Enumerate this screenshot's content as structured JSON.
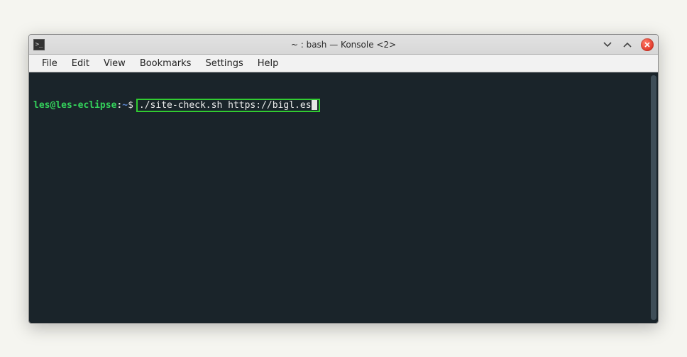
{
  "window": {
    "title": "~ : bash — Konsole <2>"
  },
  "menubar": {
    "items": [
      {
        "label": "File"
      },
      {
        "label": "Edit"
      },
      {
        "label": "View"
      },
      {
        "label": "Bookmarks"
      },
      {
        "label": "Settings"
      },
      {
        "label": "Help"
      }
    ]
  },
  "terminal": {
    "prompt": {
      "user": "les",
      "at": "@",
      "host": "les-eclipse",
      "sep": ":",
      "path": "~",
      "symbol": "$"
    },
    "command": "./site-check.sh https://bigl.es"
  },
  "icons": {
    "app": ">_"
  }
}
